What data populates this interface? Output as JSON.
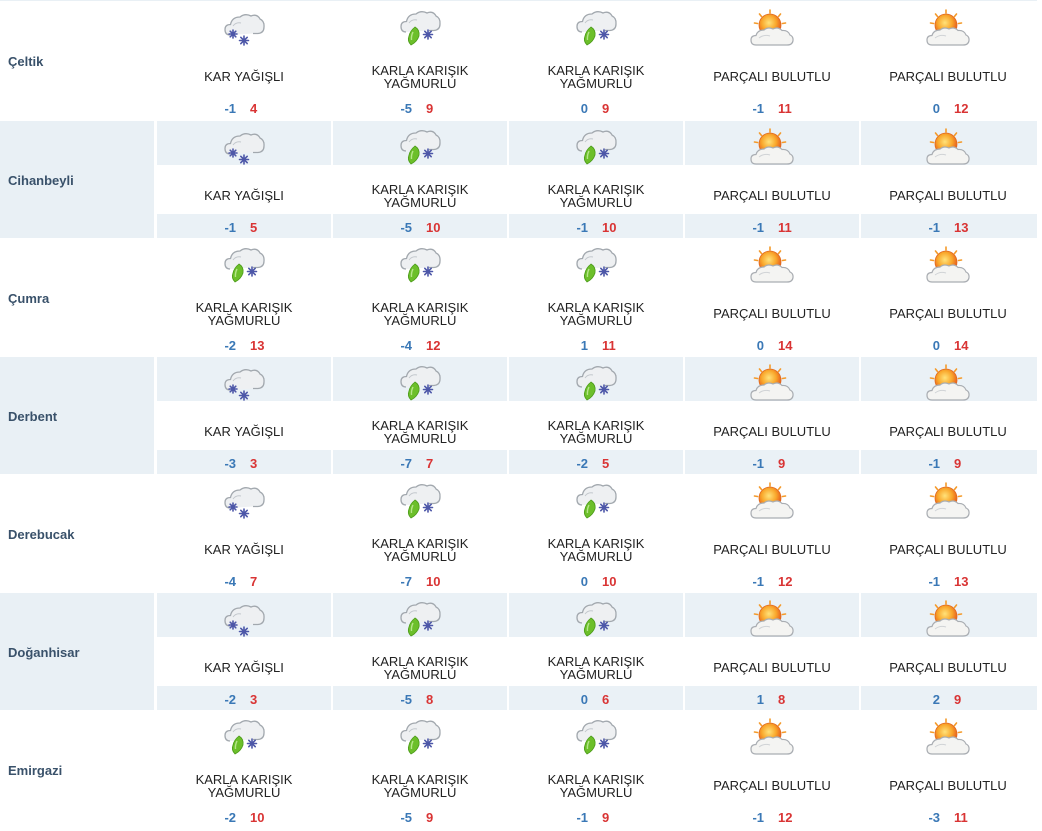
{
  "colors": {
    "row_alt_bg": "#e9f0f5",
    "city_text": "#39516a",
    "min_temp": "#3a78b6",
    "max_temp": "#d93434"
  },
  "rows": [
    {
      "city": "Çeltik",
      "days": [
        {
          "icon": "snow-icon",
          "desc": "KAR YAĞIŞLI",
          "min": "-1",
          "max": "4"
        },
        {
          "icon": "sleet-icon",
          "desc": "KARLA KARIŞIK YAĞMURLU",
          "min": "-5",
          "max": "9"
        },
        {
          "icon": "sleet-icon",
          "desc": "KARLA KARIŞIK YAĞMURLU",
          "min": "0",
          "max": "9"
        },
        {
          "icon": "partly-cloudy-icon",
          "desc": "PARÇALI BULUTLU",
          "min": "-1",
          "max": "11"
        },
        {
          "icon": "partly-cloudy-icon",
          "desc": "PARÇALI BULUTLU",
          "min": "0",
          "max": "12"
        }
      ]
    },
    {
      "city": "Cihanbeyli",
      "days": [
        {
          "icon": "snow-icon",
          "desc": "KAR YAĞIŞLI",
          "min": "-1",
          "max": "5"
        },
        {
          "icon": "sleet-icon",
          "desc": "KARLA KARIŞIK YAĞMURLU",
          "min": "-5",
          "max": "10"
        },
        {
          "icon": "sleet-icon",
          "desc": "KARLA KARIŞIK YAĞMURLU",
          "min": "-1",
          "max": "10"
        },
        {
          "icon": "partly-cloudy-icon",
          "desc": "PARÇALI BULUTLU",
          "min": "-1",
          "max": "11"
        },
        {
          "icon": "partly-cloudy-icon",
          "desc": "PARÇALI BULUTLU",
          "min": "-1",
          "max": "13"
        }
      ]
    },
    {
      "city": "Çumra",
      "days": [
        {
          "icon": "sleet-icon",
          "desc": "KARLA KARIŞIK YAĞMURLU",
          "min": "-2",
          "max": "13"
        },
        {
          "icon": "sleet-icon",
          "desc": "KARLA KARIŞIK YAĞMURLU",
          "min": "-4",
          "max": "12"
        },
        {
          "icon": "sleet-icon",
          "desc": "KARLA KARIŞIK YAĞMURLU",
          "min": "1",
          "max": "11"
        },
        {
          "icon": "partly-cloudy-icon",
          "desc": "PARÇALI BULUTLU",
          "min": "0",
          "max": "14"
        },
        {
          "icon": "partly-cloudy-icon",
          "desc": "PARÇALI BULUTLU",
          "min": "0",
          "max": "14"
        }
      ]
    },
    {
      "city": "Derbent",
      "days": [
        {
          "icon": "snow-icon",
          "desc": "KAR YAĞIŞLI",
          "min": "-3",
          "max": "3"
        },
        {
          "icon": "sleet-icon",
          "desc": "KARLA KARIŞIK YAĞMURLU",
          "min": "-7",
          "max": "7"
        },
        {
          "icon": "sleet-icon",
          "desc": "KARLA KARIŞIK YAĞMURLU",
          "min": "-2",
          "max": "5"
        },
        {
          "icon": "partly-cloudy-icon",
          "desc": "PARÇALI BULUTLU",
          "min": "-1",
          "max": "9"
        },
        {
          "icon": "partly-cloudy-icon",
          "desc": "PARÇALI BULUTLU",
          "min": "-1",
          "max": "9"
        }
      ]
    },
    {
      "city": "Derebucak",
      "days": [
        {
          "icon": "snow-icon",
          "desc": "KAR YAĞIŞLI",
          "min": "-4",
          "max": "7"
        },
        {
          "icon": "sleet-icon",
          "desc": "KARLA KARIŞIK YAĞMURLU",
          "min": "-7",
          "max": "10"
        },
        {
          "icon": "sleet-icon",
          "desc": "KARLA KARIŞIK YAĞMURLU",
          "min": "0",
          "max": "10"
        },
        {
          "icon": "partly-cloudy-icon",
          "desc": "PARÇALI BULUTLU",
          "min": "-1",
          "max": "12"
        },
        {
          "icon": "partly-cloudy-icon",
          "desc": "PARÇALI BULUTLU",
          "min": "-1",
          "max": "13"
        }
      ]
    },
    {
      "city": "Doğanhisar",
      "days": [
        {
          "icon": "snow-icon",
          "desc": "KAR YAĞIŞLI",
          "min": "-2",
          "max": "3"
        },
        {
          "icon": "sleet-icon",
          "desc": "KARLA KARIŞIK YAĞMURLU",
          "min": "-5",
          "max": "8"
        },
        {
          "icon": "sleet-icon",
          "desc": "KARLA KARIŞIK YAĞMURLU",
          "min": "0",
          "max": "6"
        },
        {
          "icon": "partly-cloudy-icon",
          "desc": "PARÇALI BULUTLU",
          "min": "1",
          "max": "8"
        },
        {
          "icon": "partly-cloudy-icon",
          "desc": "PARÇALI BULUTLU",
          "min": "2",
          "max": "9"
        }
      ]
    },
    {
      "city": "Emirgazi",
      "days": [
        {
          "icon": "sleet-icon",
          "desc": "KARLA KARIŞIK YAĞMURLU",
          "min": "-2",
          "max": "10"
        },
        {
          "icon": "sleet-icon",
          "desc": "KARLA KARIŞIK YAĞMURLU",
          "min": "-5",
          "max": "9"
        },
        {
          "icon": "sleet-icon",
          "desc": "KARLA KARIŞIK YAĞMURLU",
          "min": "-1",
          "max": "9"
        },
        {
          "icon": "partly-cloudy-icon",
          "desc": "PARÇALI BULUTLU",
          "min": "-1",
          "max": "12"
        },
        {
          "icon": "partly-cloudy-icon",
          "desc": "PARÇALI BULUTLU",
          "min": "-3",
          "max": "11"
        }
      ]
    }
  ]
}
